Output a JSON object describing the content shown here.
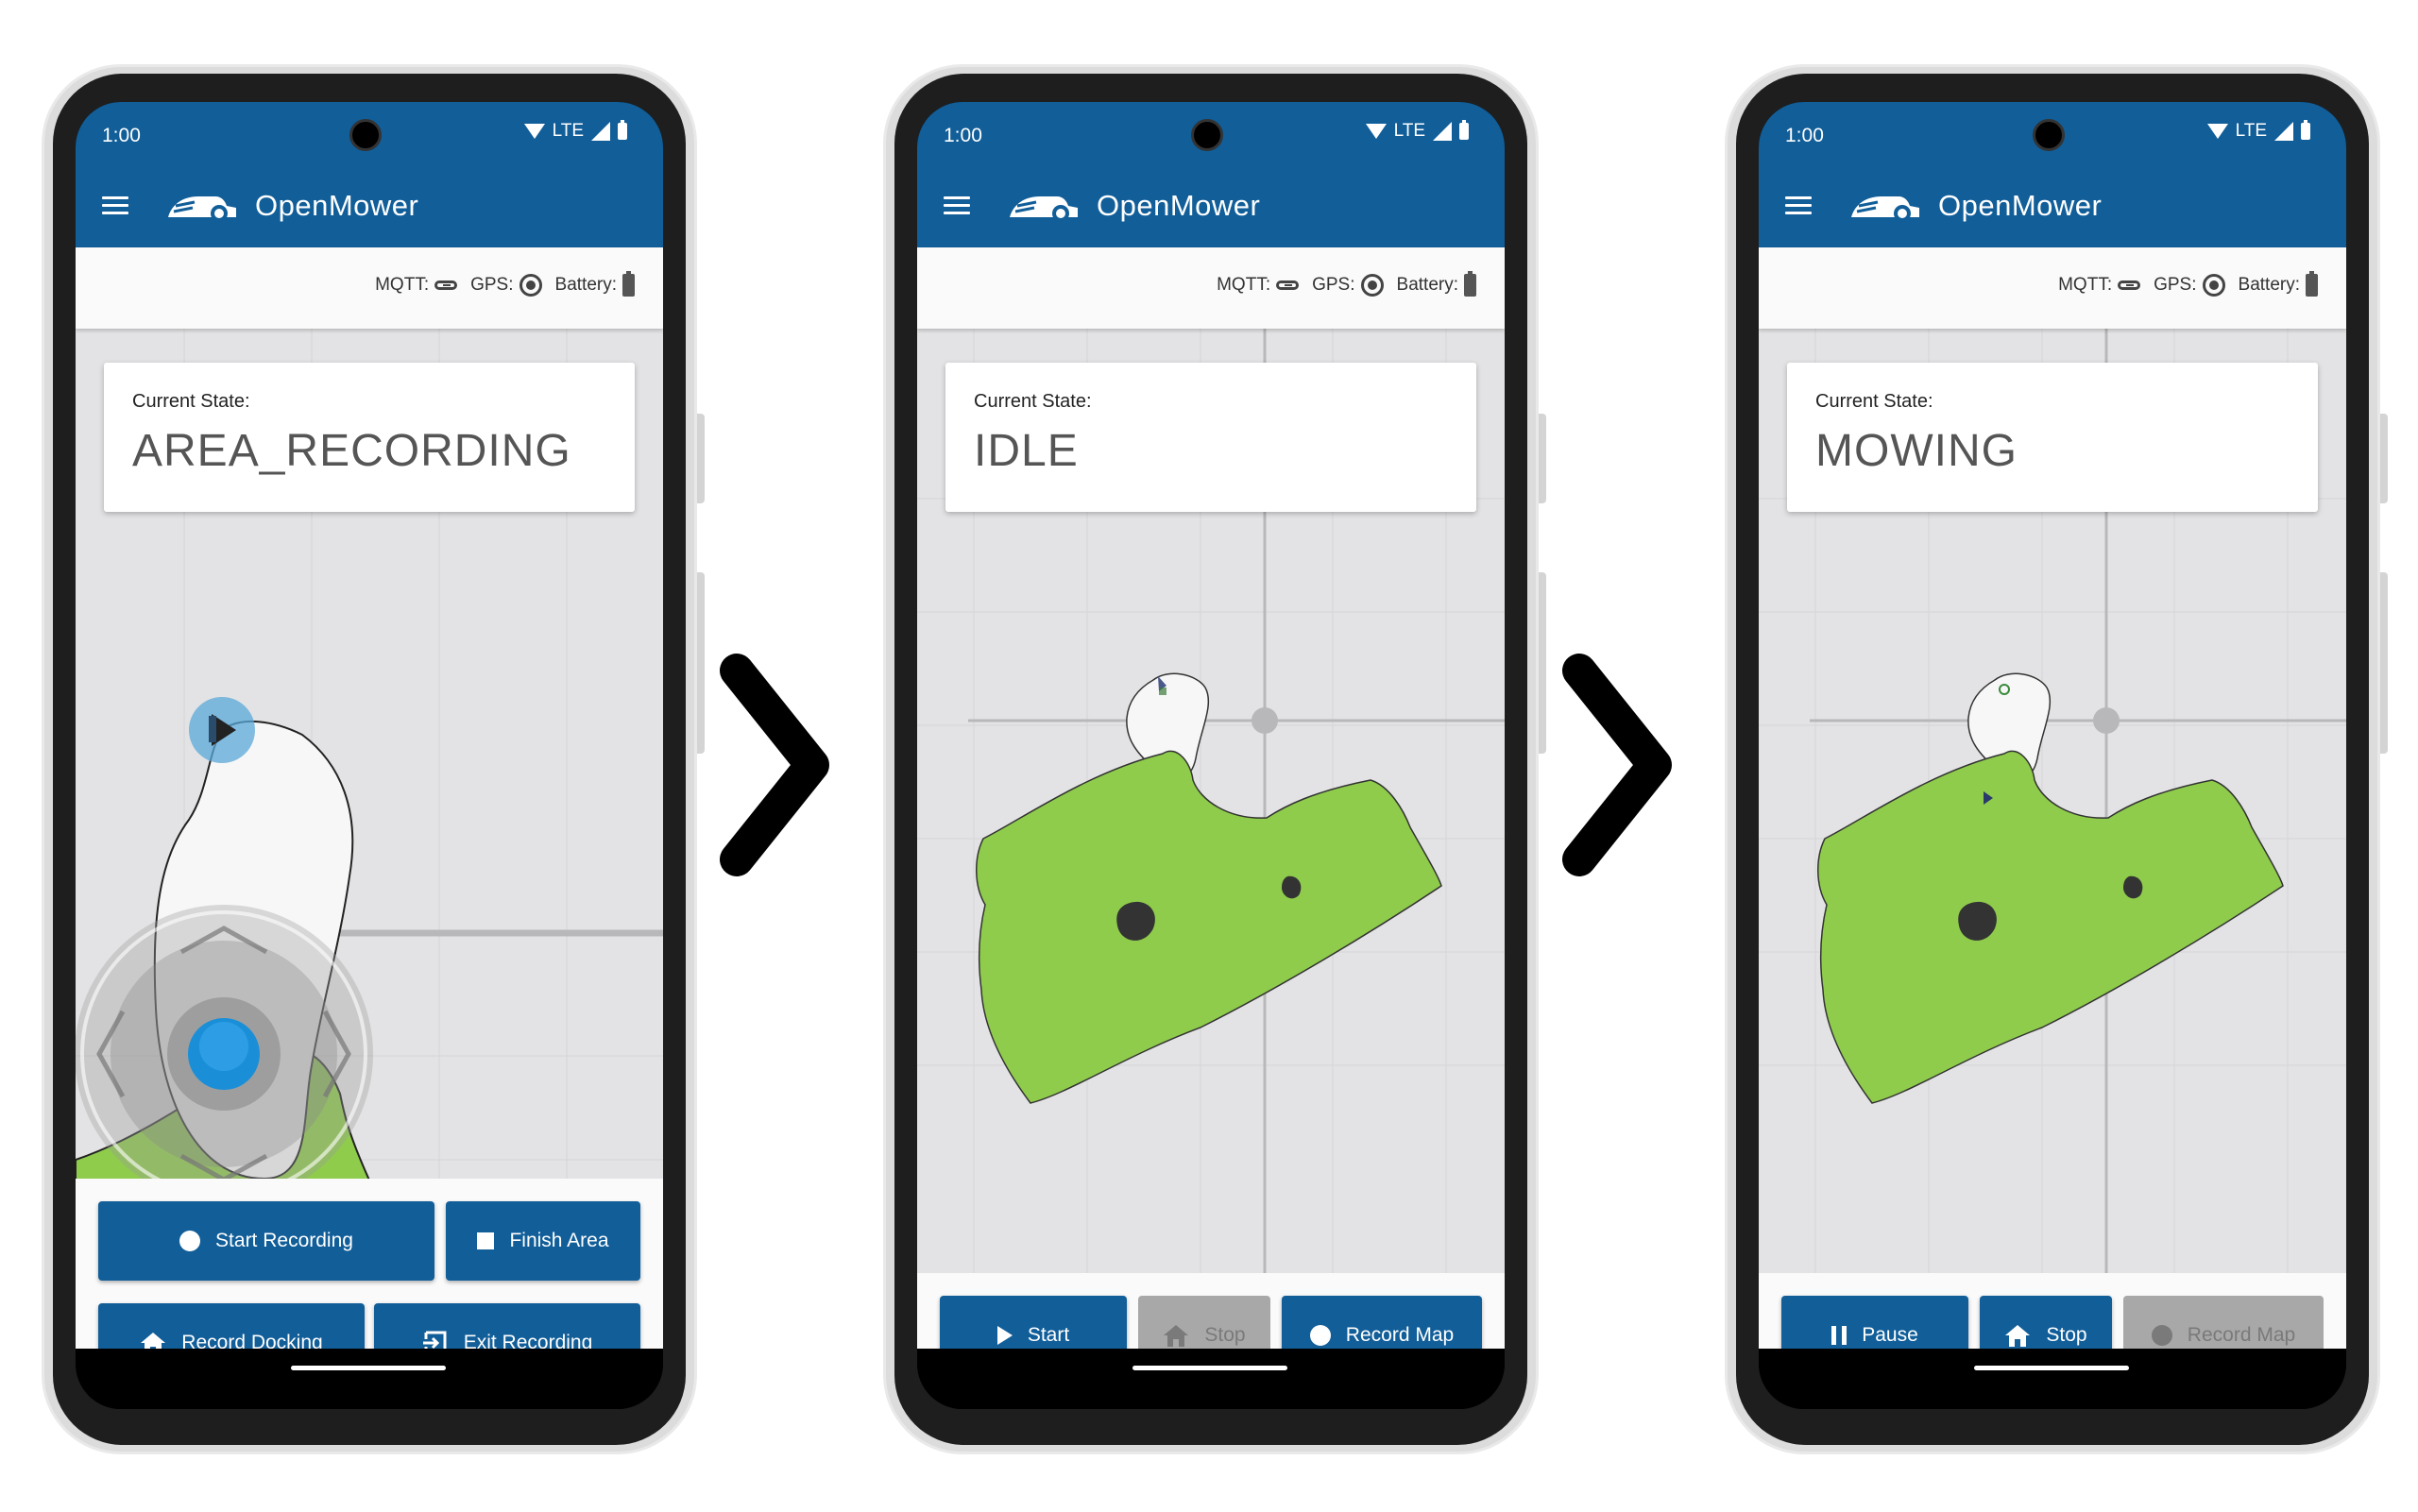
{
  "chevron_icon": "chevron-right",
  "phones": [
    {
      "status_time": "1:00",
      "status_network": "LTE",
      "app_title": "OpenMower",
      "mqtt_label": "MQTT:",
      "gps_label": "GPS:",
      "battery_label": "Battery:",
      "state_label": "Current State:",
      "state_value": "AREA_RECORDING",
      "buttons": [
        {
          "label": "Start Recording",
          "icon": "circle",
          "enabled": true
        },
        {
          "label": "Finish Area",
          "icon": "square",
          "enabled": true
        },
        {
          "label": "Record Docking",
          "icon": "home",
          "enabled": true
        },
        {
          "label": "Exit Recording",
          "icon": "exit",
          "enabled": true
        }
      ]
    },
    {
      "status_time": "1:00",
      "status_network": "LTE",
      "app_title": "OpenMower",
      "mqtt_label": "MQTT:",
      "gps_label": "GPS:",
      "battery_label": "Battery:",
      "state_label": "Current State:",
      "state_value": "IDLE",
      "buttons": [
        {
          "label": "Start",
          "icon": "play",
          "enabled": true
        },
        {
          "label": "Stop",
          "icon": "home",
          "enabled": false
        },
        {
          "label": "Record Map",
          "icon": "circle",
          "enabled": true
        }
      ]
    },
    {
      "status_time": "1:00",
      "status_network": "LTE",
      "app_title": "OpenMower",
      "mqtt_label": "MQTT:",
      "gps_label": "GPS:",
      "battery_label": "Battery:",
      "state_label": "Current State:",
      "state_value": "MOWING",
      "buttons": [
        {
          "label": "Pause",
          "icon": "pause",
          "enabled": true
        },
        {
          "label": "Stop",
          "icon": "home",
          "enabled": true
        },
        {
          "label": "Record Map",
          "icon": "circle",
          "enabled": false
        }
      ]
    }
  ],
  "colors": {
    "primary": "#115e99",
    "lawn": "#8fcc4c",
    "obstacle": "#333333",
    "map_bg": "#e4e4e6",
    "disabled_button": "#a8a8a8"
  }
}
